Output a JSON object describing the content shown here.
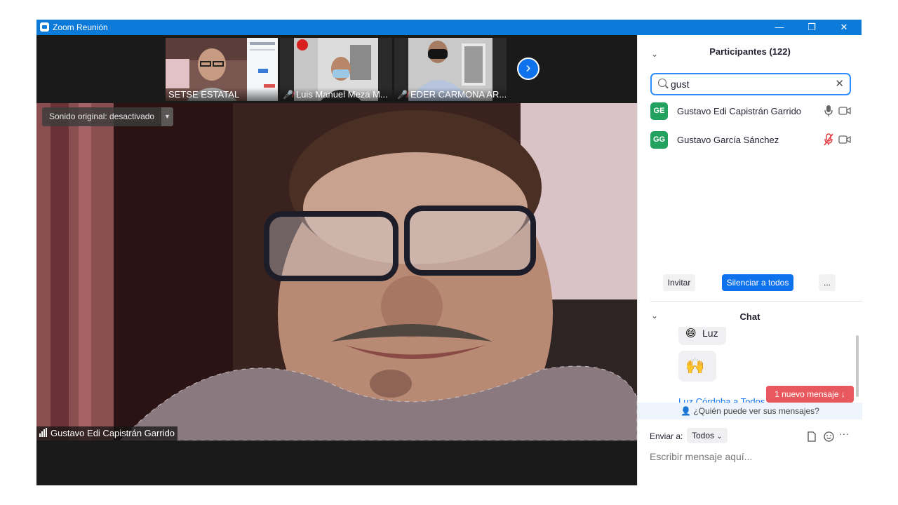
{
  "titlebar": {
    "title": "Zoom Reunión",
    "minimize": "—",
    "restore": "❐",
    "close": "✕",
    "color": "#0b7ad9"
  },
  "thumbnails": [
    {
      "name": "SETSE ESTATAL",
      "muted": false
    },
    {
      "name": "Luis Manuel Meza M...",
      "muted": true
    },
    {
      "name": "EDER CARMONA AR...",
      "muted": true
    }
  ],
  "main_video": {
    "sound_option": "Sonido original: desactivado",
    "speaker_name": "Gustavo Edi Capistrán Garrido"
  },
  "participants": {
    "title": "Participantes (122)",
    "search_value": "gust",
    "list": [
      {
        "initials": "GE",
        "name": "Gustavo Edi Capistrán Garrido",
        "mic_muted": false,
        "avatar_color": "#23a25f"
      },
      {
        "initials": "GG",
        "name": "Gustavo García Sánchez",
        "mic_muted": true,
        "avatar_color": "#23a25f"
      }
    ],
    "invite_label": "Invitar",
    "mute_all_label": "Silenciar a todos",
    "more_label": "..."
  },
  "chat": {
    "title": "Chat",
    "messages": [
      {
        "emoji": "😄",
        "text": "Luz"
      },
      {
        "emoji": "🙌",
        "text": ""
      }
    ],
    "partial_sender": "Luz Córdoba a Todos",
    "new_message_badge": "1 nuevo mensaje",
    "visibility_prompt": "¿Quién puede ver sus mensajes?",
    "send_to_label": "Enviar a:",
    "send_to_value": "Todos",
    "input_placeholder": "Escribir mensaje aquí...",
    "accent": "#0e72ed",
    "badge_color": "#e8595f"
  }
}
